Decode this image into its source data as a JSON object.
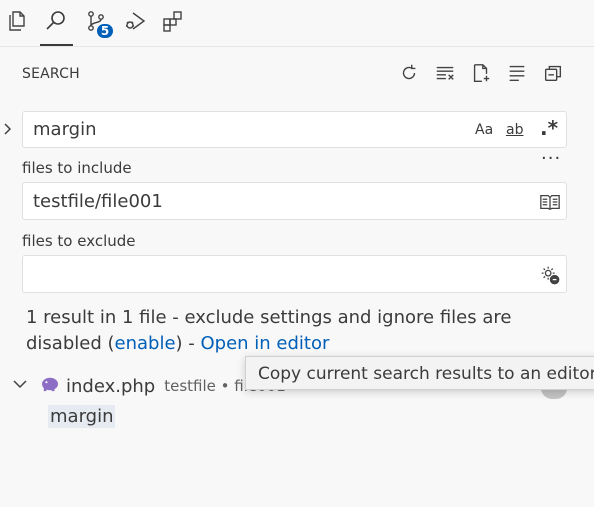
{
  "activity_bar": {
    "items": [
      {
        "name": "explorer-icon"
      },
      {
        "name": "search-icon",
        "active": true
      },
      {
        "name": "source-control-icon",
        "badge": "5"
      },
      {
        "name": "run-debug-icon"
      },
      {
        "name": "extensions-icon"
      }
    ]
  },
  "search_view": {
    "title": "SEARCH",
    "actions": [
      "refresh-icon",
      "clear-results-icon",
      "new-search-editor-icon",
      "view-as-tree-icon",
      "collapse-all-icon"
    ],
    "query": {
      "value": "margin",
      "options": {
        "match_case": "Aa",
        "whole_word": "ab",
        "regex": ".*"
      }
    },
    "more_label": "···",
    "include": {
      "label": "files to include",
      "value": "testfile/file001"
    },
    "exclude": {
      "label": "files to exclude",
      "value": ""
    },
    "message": {
      "text_before": "1 result in 1 file - exclude settings and ignore files are disabled (",
      "enable_link": "enable",
      "text_middle": ") - ",
      "open_editor_link": "Open in editor"
    },
    "results": [
      {
        "file": "index.php",
        "folder": "testfile • file001",
        "matches": [
          "margin"
        ]
      }
    ]
  },
  "tooltip": {
    "text": "Copy current search results to an editor (Al"
  },
  "colors": {
    "accent": "#005fb8",
    "php_icon": "#8c6fc4",
    "background": "#f8f8f8"
  }
}
